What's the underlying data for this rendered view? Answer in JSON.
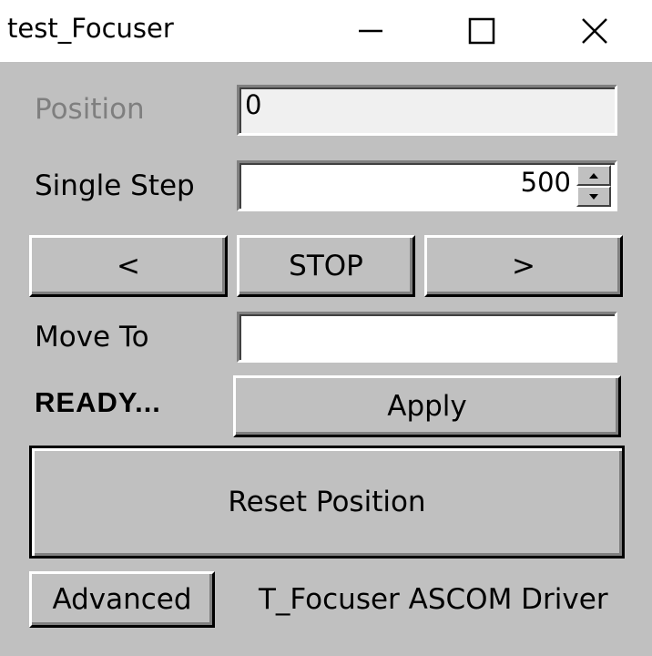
{
  "window": {
    "title": "test_Focuser",
    "controls": [
      "minimize-icon",
      "maximize-icon",
      "close-icon"
    ]
  },
  "position": {
    "label": "Position",
    "value": "0"
  },
  "single_step": {
    "label": "Single Step",
    "value": "500"
  },
  "move_buttons": {
    "left": "<",
    "stop": "STOP",
    "right": ">"
  },
  "move_to": {
    "label": "Move To",
    "value": ""
  },
  "status": {
    "text": "READY..."
  },
  "apply": {
    "label": "Apply"
  },
  "reset": {
    "label": "Reset Position"
  },
  "advanced": {
    "label": "Advanced"
  },
  "footer": {
    "driver_text": "T_Focuser ASCOM Driver"
  },
  "colors": {
    "face": "#c0c0c0",
    "titlebar": "#ffffff",
    "disabled_text": "#7f7f7f"
  }
}
